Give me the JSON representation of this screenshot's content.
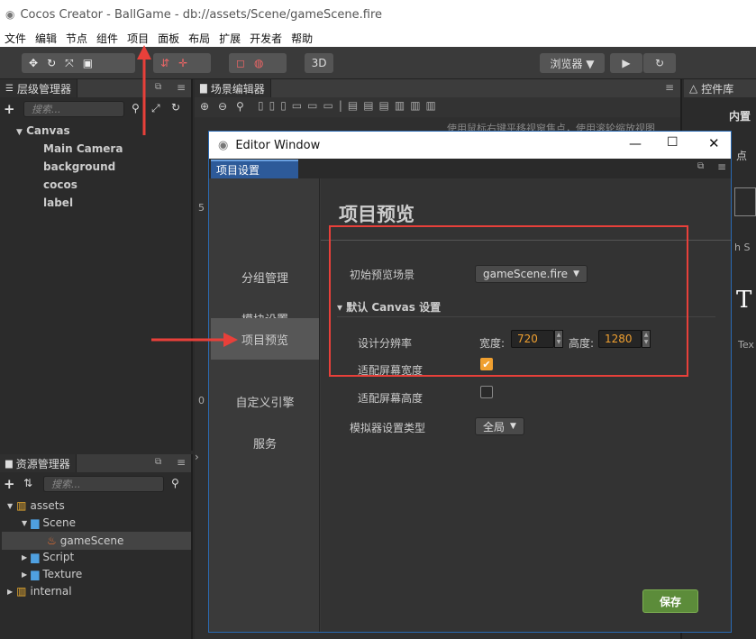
{
  "window": {
    "title": "Cocos Creator - BallGame - db://assets/Scene/gameScene.fire"
  },
  "menubar": {
    "items": [
      "文件",
      "编辑",
      "节点",
      "组件",
      "项目",
      "面板",
      "布局",
      "扩展",
      "开发者",
      "帮助"
    ]
  },
  "toolbar": {
    "mode_3d": "3D",
    "browser": "浏览器 ▼"
  },
  "hierarchy": {
    "title": "层级管理器",
    "search_placeholder": "搜索...",
    "root": "Canvas",
    "children": [
      "Main Camera",
      "background",
      "cocos",
      "label"
    ]
  },
  "assets": {
    "title": "资源管理器",
    "search_placeholder": "搜索...",
    "items": [
      {
        "label": "assets",
        "depth": 0,
        "expanded": true,
        "icon": "db-icon"
      },
      {
        "label": "Scene",
        "depth": 1,
        "expanded": true,
        "icon": "folder-icon"
      },
      {
        "label": "gameScene",
        "depth": 2,
        "selected": true,
        "icon": "scene-icon"
      },
      {
        "label": "Script",
        "depth": 1,
        "expanded": false,
        "icon": "folder-icon"
      },
      {
        "label": "Texture",
        "depth": 1,
        "expanded": false,
        "icon": "folder-icon"
      },
      {
        "label": "internal",
        "depth": 0,
        "expanded": false,
        "icon": "db-icon"
      }
    ]
  },
  "scene": {
    "title": "场景编辑器",
    "hint": "使用鼠标右键平移视窗焦点，使用滚轮缩放视图",
    "ruler": [
      "5",
      "0"
    ]
  },
  "widgets": {
    "title": "控件库",
    "builtin": "内置",
    "frag1": "点",
    "frag2": "h S",
    "frag3": "T",
    "frag4": "Tex"
  },
  "editor": {
    "title": "Editor Window",
    "tab": "项目设置",
    "sidebar": [
      "分组管理",
      "模块设置",
      "项目预览",
      "自定义引擎",
      "服务"
    ],
    "selected_index": 2,
    "heading": "项目预览",
    "start_scene_label": "初始预览场景",
    "start_scene_value": "gameScene.fire",
    "canvas_section": "▾ 默认 Canvas 设置",
    "resolution_label": "设计分辨率",
    "width_label": "宽度:",
    "width_value": "720",
    "height_label": "高度:",
    "height_value": "1280",
    "fit_width_label": "适配屏幕宽度",
    "fit_width": true,
    "fit_height_label": "适配屏幕高度",
    "fit_height": false,
    "simulator_label": "模拟器设置类型",
    "simulator_value": "全局",
    "save": "保存"
  },
  "colors": {
    "accent": "#f0a030",
    "annotation": "#e8403a",
    "save": "#5c8c3a",
    "selection": "#2d5a99"
  }
}
